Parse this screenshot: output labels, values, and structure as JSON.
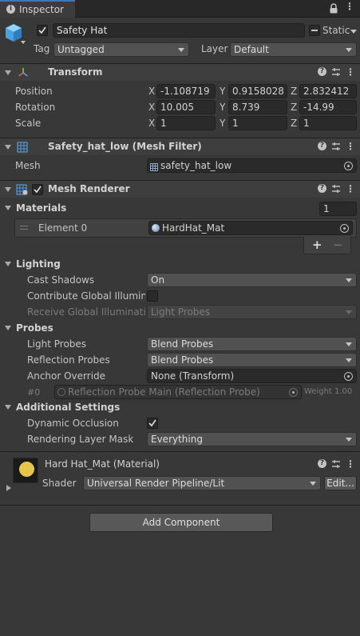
{
  "tab": {
    "label": "Inspector"
  },
  "object": {
    "name": "Safety Hat",
    "static_label": "Static",
    "tag_label": "Tag",
    "tag_value": "Untagged",
    "layer_label": "Layer",
    "layer_value": "Default"
  },
  "transform": {
    "title": "Transform",
    "rows": [
      {
        "label": "Position",
        "x": "-1.108719",
        "y": "0.9158028",
        "z": "2.832412"
      },
      {
        "label": "Rotation",
        "x": "10.005",
        "y": "8.739",
        "z": "-14.99"
      },
      {
        "label": "Scale",
        "x": "1",
        "y": "1",
        "z": "1"
      }
    ],
    "axis": {
      "x": "X",
      "y": "Y",
      "z": "Z"
    }
  },
  "mesh_filter": {
    "title": "Safety_hat_low (Mesh Filter)",
    "mesh_label": "Mesh",
    "mesh_value": "safety_hat_low"
  },
  "mesh_renderer": {
    "title": "Mesh Renderer",
    "materials_label": "Materials",
    "materials_count": "1",
    "element_label": "Element 0",
    "element_value": "HardHat_Mat",
    "plus": "+",
    "minus": "−",
    "lighting_label": "Lighting",
    "cast_shadows_label": "Cast Shadows",
    "cast_shadows_value": "On",
    "contribute_gi_label": "Contribute Global Illuminat",
    "receive_gi_label": "Receive Global Illumination",
    "receive_gi_value": "Light Probes",
    "probes_label": "Probes",
    "light_probes_label": "Light Probes",
    "light_probes_value": "Blend Probes",
    "reflection_probes_label": "Reflection Probes",
    "reflection_probes_value": "Blend Probes",
    "anchor_label": "Anchor Override",
    "anchor_value": "None (Transform)",
    "probe_index": "#0",
    "probe_value": "Reflection Probe Main (Reflection Probe)",
    "probe_weight": "Weight 1.00",
    "additional_label": "Additional Settings",
    "dynamic_occlusion_label": "Dynamic Occlusion",
    "rendering_layer_label": "Rendering Layer Mask",
    "rendering_layer_value": "Everything"
  },
  "material": {
    "title": "Hard Hat_Mat (Material)",
    "shader_label": "Shader",
    "shader_value": "Universal Render Pipeline/Lit",
    "edit_label": "Edit..."
  },
  "add_component": {
    "label": "Add Component"
  }
}
